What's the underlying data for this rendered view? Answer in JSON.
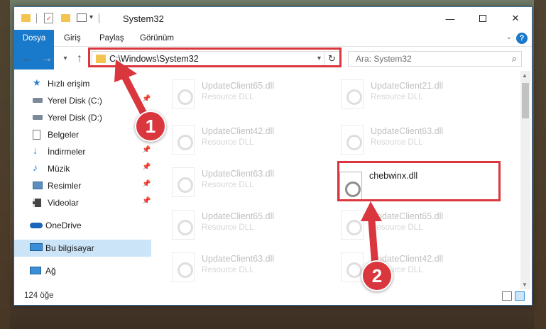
{
  "window": {
    "title": "System32"
  },
  "ribbon": {
    "tabs": [
      "Dosya",
      "Giriş",
      "Paylaş",
      "Görünüm"
    ],
    "help": "?"
  },
  "address": {
    "path": "C:\\Windows\\System32",
    "refresh_glyph": "↻"
  },
  "search": {
    "placeholder": "Ara: System32"
  },
  "sidebar": {
    "items": [
      {
        "label": "Hızlı erişim",
        "icon": "star-icon"
      },
      {
        "label": "Yerel Disk (C:)",
        "icon": "drive-icon",
        "pinned": true
      },
      {
        "label": "Yerel Disk (D:)",
        "icon": "drive-icon"
      },
      {
        "label": "Belgeler",
        "icon": "documents-icon",
        "pinned": true
      },
      {
        "label": "İndirmeler",
        "icon": "download-icon",
        "pinned": true
      },
      {
        "label": "Müzik",
        "icon": "music-icon",
        "pinned": true
      },
      {
        "label": "Resimler",
        "icon": "pictures-icon",
        "pinned": true
      },
      {
        "label": "Videolar",
        "icon": "videos-icon",
        "pinned": true
      },
      {
        "label": "OneDrive",
        "icon": "cloud-icon"
      },
      {
        "label": "Bu bilgisayar",
        "icon": "computer-icon",
        "selected": true
      },
      {
        "label": "Ağ",
        "icon": "network-icon"
      }
    ]
  },
  "files": [
    {
      "name": "UpdateClient65.dll",
      "type": "Resource DLL"
    },
    {
      "name": "UpdateClient21.dll",
      "type": "Resource DLL"
    },
    {
      "name": "UpdateClient42.dll",
      "type": "Resource DLL"
    },
    {
      "name": "UpdateClient63.dll",
      "type": "Resource DLL"
    },
    {
      "name": "UpdateClient63.dll",
      "type": "Resource DLL"
    },
    {
      "name": "chebwinx.dll",
      "type": ""
    },
    {
      "name": "UpdateClient65.dll",
      "type": "Resource DLL"
    },
    {
      "name": "UpdateClient65.dll",
      "type": "Resource DLL"
    },
    {
      "name": "UpdateClient63.dll",
      "type": "Resource DLL"
    },
    {
      "name": "UpdateClient42.dll",
      "type": "Resource DLL"
    }
  ],
  "status": {
    "count": "124 öğe"
  },
  "annotations": {
    "step1": "1",
    "step2": "2",
    "color": "#d9363e"
  },
  "colors": {
    "accent": "#1979ca",
    "selection": "#cce4f7",
    "folder": "#f3c44f"
  }
}
